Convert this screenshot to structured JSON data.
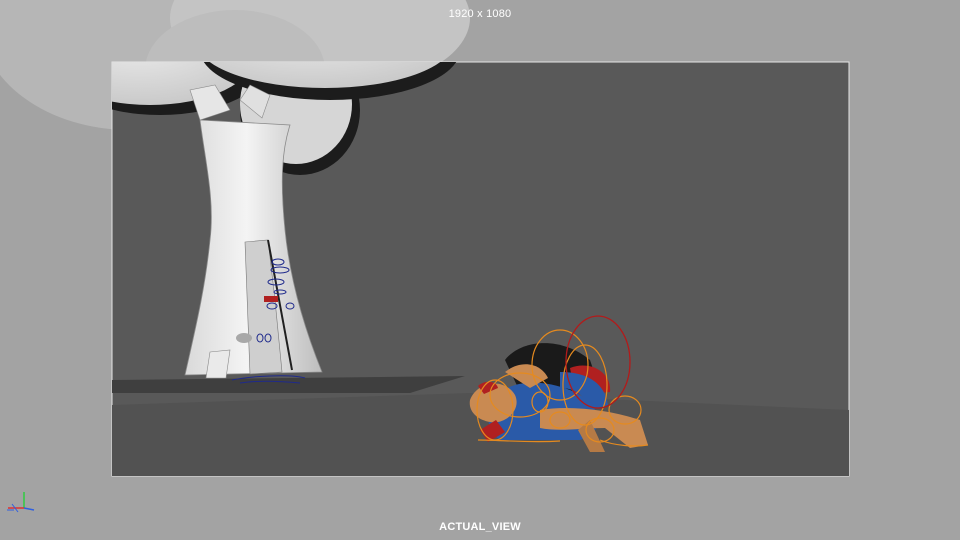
{
  "viewport": {
    "resolution_label": "1920 x 1080",
    "camera_label": "ACTUAL_VIEW"
  },
  "colors": {
    "outer_background": "#a3a3a3",
    "gate_background": "#595959",
    "gate_border": "#e6e6e6",
    "rig_control_orange": "#e58a1f",
    "rig_control_red": "#b31a1a",
    "rig_control_blue": "#1f2a8c",
    "character_skin": "#c98a52",
    "character_shirt_blue": "#2a5aa8",
    "character_red": "#b02020",
    "character_black": "#1a1a1a"
  },
  "icons": {
    "axis_gizmo": "xyz-axis-icon"
  }
}
